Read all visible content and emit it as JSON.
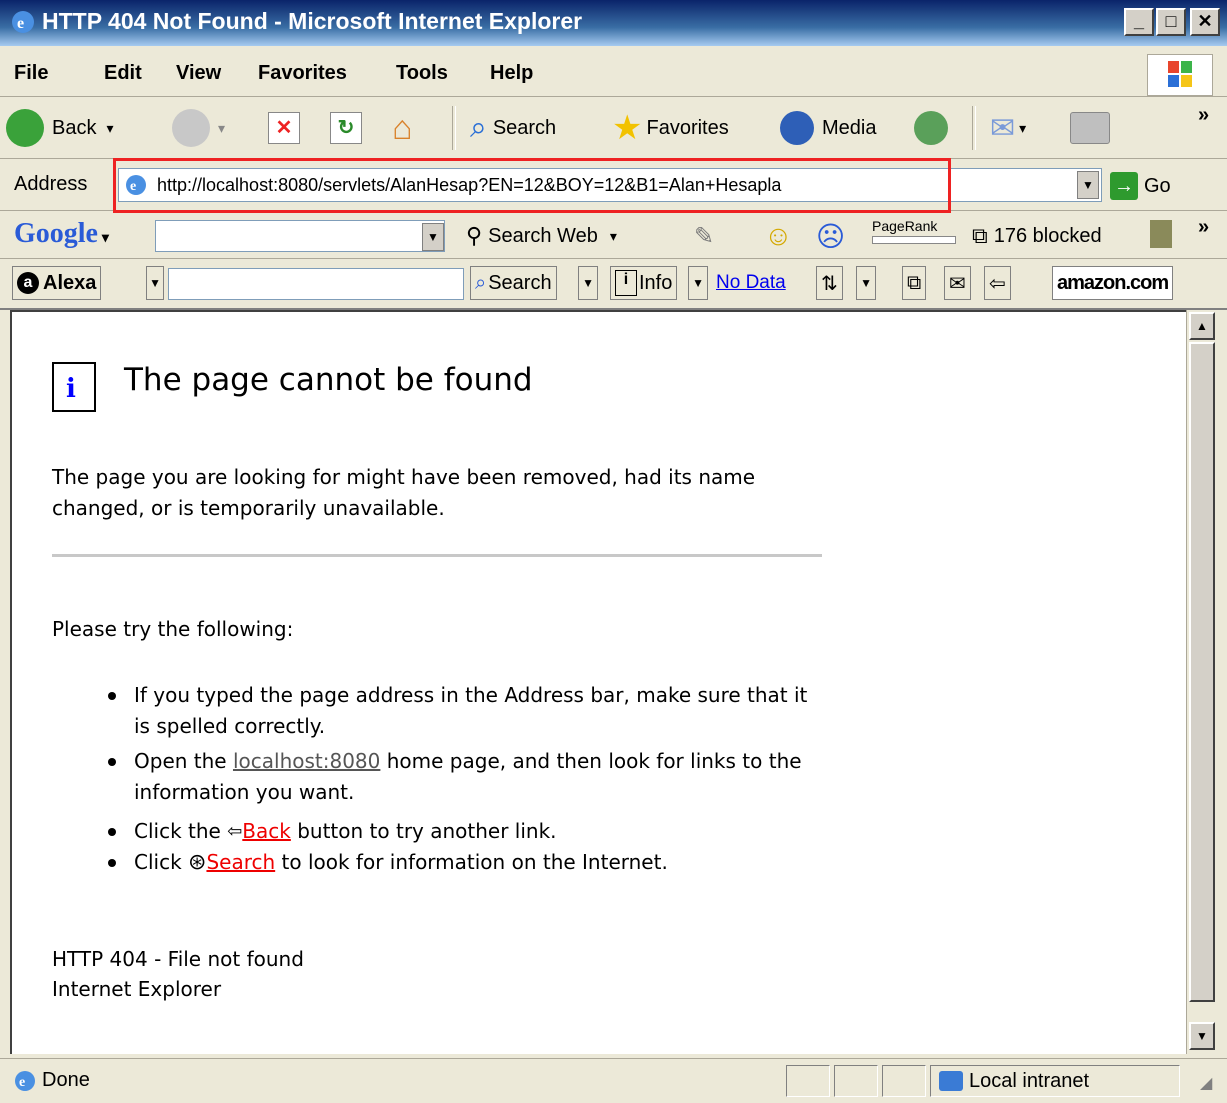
{
  "window": {
    "title": "HTTP 404 Not Found - Microsoft Internet Explorer"
  },
  "menubar": {
    "items": [
      "File",
      "Edit",
      "View",
      "Favorites",
      "Tools",
      "Help"
    ]
  },
  "toolbar": {
    "back": "Back",
    "search": "Search",
    "favorites": "Favorites",
    "media": "Media"
  },
  "address": {
    "label": "Address",
    "url": "http://localhost:8080/servlets/AlanHesap?EN=12&BOY=12&B1=Alan+Hesapla",
    "go": "Go"
  },
  "googlebar": {
    "logo": "Google",
    "search_web": "Search Web",
    "pagerank": "PageRank",
    "blocked": "176 blocked"
  },
  "alexabar": {
    "logo": "Alexa",
    "search": "Search",
    "info": "Info",
    "no_data": "No Data",
    "amazon": "amazon.com"
  },
  "page": {
    "heading": "The page cannot be found",
    "intro": "The page you are looking for might have been removed, had its name changed, or is temporarily unavailable.",
    "try": "Please try the following:",
    "bullet1": "If you typed the page address in the Address bar, make sure that it is spelled correctly.",
    "bullet2_pre": "Open the",
    "bullet2_link": "localhost:8080",
    "bullet2_post": "home page, and then look for links to the information you want.",
    "bullet3_pre": "Click the",
    "bullet3_link": "Back",
    "bullet3_post": "button to try another link.",
    "bullet4_pre": "Click",
    "bullet4_link": "Search",
    "bullet4_post": "to look for information on the Internet.",
    "footer1": "HTTP 404 - File not found",
    "footer2": "Internet Explorer"
  },
  "status": {
    "text": "Done",
    "zone": "Local intranet"
  },
  "colors": {
    "highlight_box": "#e22222",
    "link_red": "#ee0000",
    "title_bar": "#0a246a"
  }
}
